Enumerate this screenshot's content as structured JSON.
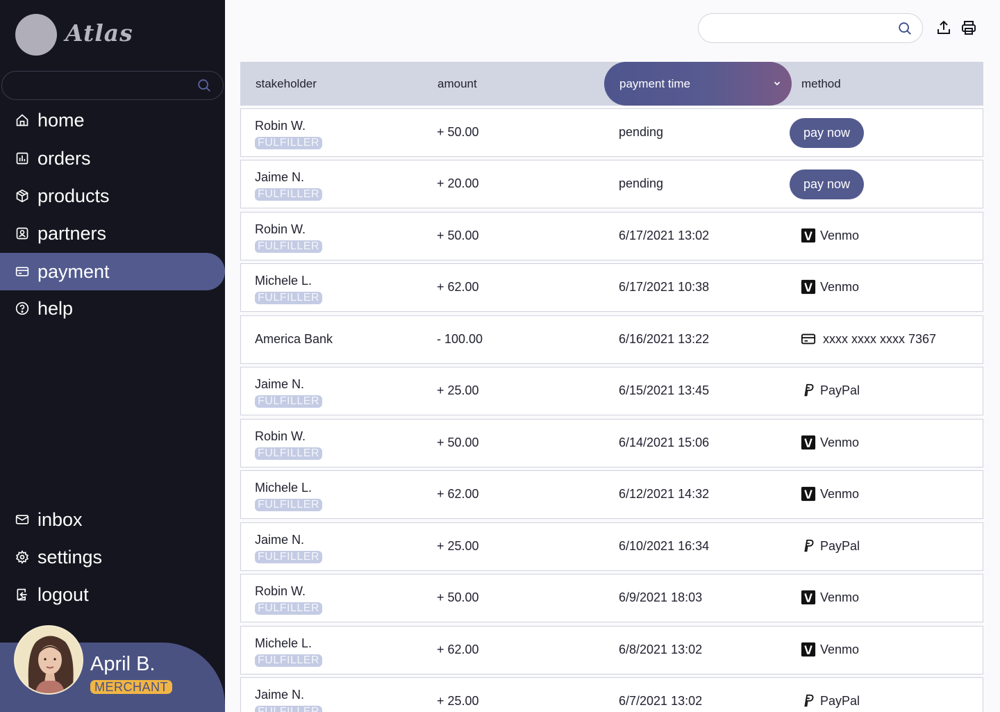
{
  "app": {
    "logo_text": "Atlas"
  },
  "sidebar": {
    "search_placeholder": "",
    "nav": [
      {
        "label": "home",
        "icon": "home-icon"
      },
      {
        "label": "orders",
        "icon": "orders-icon"
      },
      {
        "label": "products",
        "icon": "box-icon"
      },
      {
        "label": "partners",
        "icon": "partners-icon"
      },
      {
        "label": "payment",
        "icon": "card-icon",
        "active": true
      },
      {
        "label": "help",
        "icon": "help-icon"
      }
    ],
    "bottom_nav": [
      {
        "label": "inbox",
        "icon": "mail-icon"
      },
      {
        "label": "settings",
        "icon": "gear-icon"
      },
      {
        "label": "logout",
        "icon": "logout-icon"
      }
    ],
    "profile": {
      "name": "April B.",
      "role": "MERCHANT"
    }
  },
  "header": {
    "search_placeholder": ""
  },
  "table": {
    "columns": [
      "stakeholder",
      "amount",
      "payment time",
      "method"
    ],
    "sorted_column": "payment time",
    "pay_button_label": "pay now",
    "rows": [
      {
        "name": "Robin W.",
        "tag": "FULFILLER",
        "amount": "+ 50.00",
        "time": "pending",
        "method": "pay now",
        "method_type": "button"
      },
      {
        "name": "Jaime N.",
        "tag": "FULFILLER",
        "amount": "+ 20.00",
        "time": "pending",
        "method": "pay now",
        "method_type": "button"
      },
      {
        "name": "Robin W.",
        "tag": "FULFILLER",
        "amount": "+ 50.00",
        "time": "6/17/2021  13:02",
        "method": "Venmo",
        "method_type": "venmo"
      },
      {
        "name": "Michele L.",
        "tag": "FULFILLER",
        "amount": "+ 62.00",
        "time": "6/17/2021  10:38",
        "method": "Venmo",
        "method_type": "venmo"
      },
      {
        "name": "America Bank",
        "tag": "",
        "amount": "- 100.00",
        "time": "6/16/2021  13:22",
        "method": "xxxx xxxx xxxx 7367",
        "method_type": "card"
      },
      {
        "name": "Jaime N.",
        "tag": "FULFILLER",
        "amount": "+ 25.00",
        "time": "6/15/2021  13:45",
        "method": "PayPal",
        "method_type": "paypal"
      },
      {
        "name": "Robin W.",
        "tag": "FULFILLER",
        "amount": "+ 50.00",
        "time": "6/14/2021  15:06",
        "method": "Venmo",
        "method_type": "venmo"
      },
      {
        "name": "Michele L.",
        "tag": "FULFILLER",
        "amount": "+ 62.00",
        "time": "6/12/2021  14:32",
        "method": "Venmo",
        "method_type": "venmo"
      },
      {
        "name": "Jaime N.",
        "tag": "FULFILLER",
        "amount": "+ 25.00",
        "time": "6/10/2021  16:34",
        "method": "PayPal",
        "method_type": "paypal"
      },
      {
        "name": "Robin W.",
        "tag": "FULFILLER",
        "amount": "+ 50.00",
        "time": "6/9/2021  18:03",
        "method": "Venmo",
        "method_type": "venmo"
      },
      {
        "name": "Michele L.",
        "tag": "FULFILLER",
        "amount": "+ 62.00",
        "time": "6/8/2021  13:02",
        "method": "Venmo",
        "method_type": "venmo"
      },
      {
        "name": "Jaime N.",
        "tag": "FULFILLER",
        "amount": "+ 25.00",
        "time": "6/7/2021  13:02",
        "method": "PayPal",
        "method_type": "paypal"
      }
    ]
  },
  "colors": {
    "sidebar_bg": "#15151f",
    "accent": "#525a8e",
    "merchant_badge": "#f0b545",
    "fulfiller_badge": "#c4cbe4",
    "header_bg": "#d2d5e2"
  }
}
